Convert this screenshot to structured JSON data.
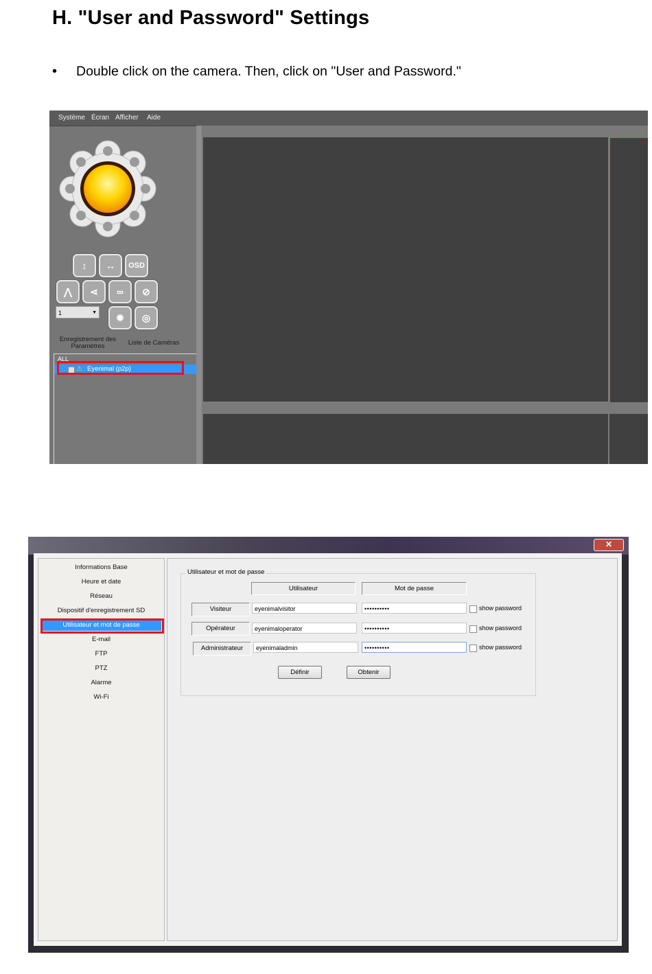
{
  "page": {
    "heading": "H. \"User and Password\" Settings",
    "bullet": "•",
    "instruction": "Double click on the camera. Then, click on \"User and Password.\""
  },
  "screenshot1": {
    "menu": [
      "Système",
      "Écran",
      "Afficher",
      "Aide"
    ],
    "ptz_buttons": [
      "OSD"
    ],
    "preset_value": "1",
    "tab_labels": {
      "recording": [
        "Enregistrement des",
        "Paramètres"
      ],
      "camera_list": "Liste de Caméras"
    },
    "tree": {
      "root": "ALL",
      "camera": "Eyenimal (p2p)"
    }
  },
  "screenshot2": {
    "close_symbol": "✕",
    "nav": [
      "Informations Base",
      "Heure et date",
      "Réseau",
      "Dispositif d'enregistrement SD",
      "Utilisateur et mot de passe",
      "E-mail",
      "FTP",
      "PTZ",
      "Alarme",
      "Wi-Fi"
    ],
    "group_title": "Utilisateur et mot de passe",
    "col_user": "Utilisateur",
    "col_password": "Mot de passe",
    "rows": [
      {
        "role": "Visiteur",
        "user": "eyenimalvisitor",
        "password": "••••••••••",
        "show": "show password"
      },
      {
        "role": "Opérateur",
        "user": "eyenimaloperator",
        "password": "••••••••••",
        "show": "show password"
      },
      {
        "role": "Administrateur",
        "user": "eyenimaladmin",
        "password": "••••••••••",
        "show": "show password"
      }
    ],
    "btn_set": "Définir",
    "btn_get": "Obtenir"
  }
}
